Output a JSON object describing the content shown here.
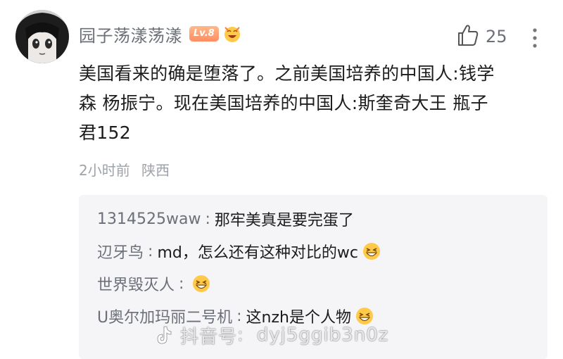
{
  "comment": {
    "username": "园子荡漾荡漾",
    "level_badge": "Lv.8",
    "like_count": "25",
    "text": "美国看来的确是堕落了。之前美国培养的中国人:钱学森 杨振宁。现在美国培养的中国人:斯奎奇大王 瓶子君152",
    "time": "2小时前",
    "location": "陕西"
  },
  "replies": [
    {
      "user": "1314525waw",
      "text": "那牢美真是要完蛋了",
      "emoji": ""
    },
    {
      "user": "辺牙鸟",
      "text": "md，怎么还有这种对比的wc",
      "emoji": "grinning-squint-emoji"
    },
    {
      "user": "世界毁灭人",
      "text": "",
      "emoji": "grinning-squint-emoji"
    },
    {
      "user": "U奥尔加玛丽二号机",
      "text": "这nzh是个人物",
      "emoji": "grinning-squint-emoji"
    }
  ],
  "reply_separator": ":",
  "watermark": {
    "brand": "抖音号",
    "id": "dyj5ggib3n0z"
  },
  "colors": {
    "badge": "#ff8c62",
    "secondary_text": "#6b6f78",
    "meta_text": "#9ea2a9",
    "reply_bg": "#f5f5f8"
  }
}
